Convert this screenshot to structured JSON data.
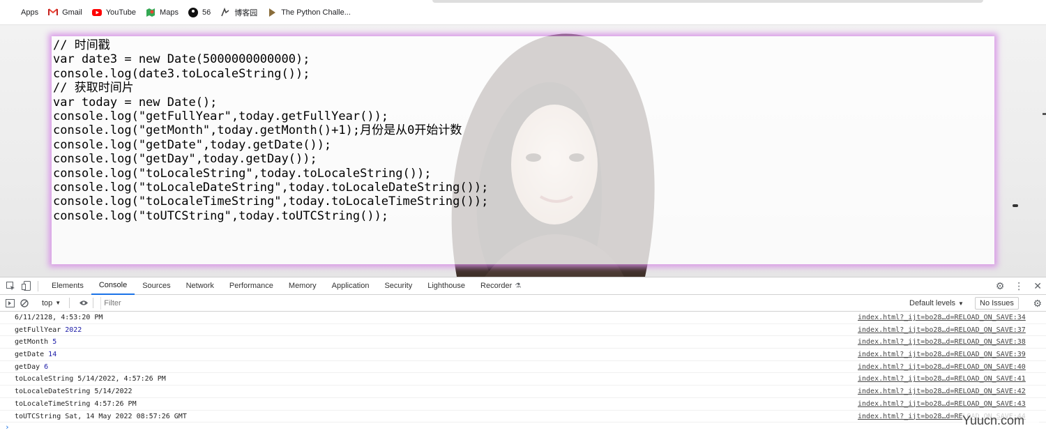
{
  "bookmarks": [
    {
      "label": "Apps",
      "icon": "apps-grid-icon"
    },
    {
      "label": "Gmail",
      "icon": "gmail-icon"
    },
    {
      "label": "YouTube",
      "icon": "youtube-icon"
    },
    {
      "label": "Maps",
      "icon": "maps-icon"
    },
    {
      "label": "56",
      "icon": "site-56-icon"
    },
    {
      "label": "博客园",
      "icon": "cnblogs-icon"
    },
    {
      "label": "The Python Challe...",
      "icon": "python-challenge-icon"
    }
  ],
  "code": {
    "lines": [
      "// 时间戳",
      "var date3 = new Date(5000000000000);",
      "console.log(date3.toLocaleString());",
      "// 获取时间片",
      "var today = new Date();",
      "console.log(\"getFullYear\",today.getFullYear());",
      "console.log(\"getMonth\",today.getMonth()+1);月份是从0开始计数",
      "console.log(\"getDate\",today.getDate());",
      "console.log(\"getDay\",today.getDay());",
      "console.log(\"toLocaleString\",today.toLocaleString());",
      "console.log(\"toLocaleDateString\",today.toLocaleDateString());",
      "console.log(\"toLocaleTimeString\",today.toLocaleTimeString());",
      "console.log(\"toUTCString\",today.toUTCString());"
    ]
  },
  "devtools": {
    "tabs": [
      "Elements",
      "Console",
      "Sources",
      "Network",
      "Performance",
      "Memory",
      "Application",
      "Security",
      "Lighthouse",
      "Recorder"
    ],
    "active_tab": "Console",
    "context": "top",
    "filter_placeholder": "Filter",
    "levels": "Default levels",
    "issues": "No Issues"
  },
  "console": {
    "rows": [
      {
        "text": "6/11/2128, 4:53:20 PM",
        "value": "",
        "source": "index.html?_ijt=bo28…d=RELOAD_ON_SAVE:34"
      },
      {
        "text": "getFullYear ",
        "value": "2022",
        "source": "index.html?_ijt=bo28…d=RELOAD_ON_SAVE:37"
      },
      {
        "text": "getMonth ",
        "value": "5",
        "source": "index.html?_ijt=bo28…d=RELOAD_ON_SAVE:38"
      },
      {
        "text": "getDate ",
        "value": "14",
        "source": "index.html?_ijt=bo28…d=RELOAD_ON_SAVE:39"
      },
      {
        "text": "getDay ",
        "value": "6",
        "source": "index.html?_ijt=bo28…d=RELOAD_ON_SAVE:40"
      },
      {
        "text": "toLocaleString 5/14/2022, 4:57:26 PM",
        "value": "",
        "source": "index.html?_ijt=bo28…d=RELOAD_ON_SAVE:41"
      },
      {
        "text": "toLocaleDateString 5/14/2022",
        "value": "",
        "source": "index.html?_ijt=bo28…d=RELOAD_ON_SAVE:42"
      },
      {
        "text": "toLocaleTimeString 4:57:26 PM",
        "value": "",
        "source": "index.html?_ijt=bo28…d=RELOAD_ON_SAVE:43"
      },
      {
        "text": "toUTCString Sat, 14 May 2022 08:57:26 GMT",
        "value": "",
        "source": "index.html?_ijt=bo28…d=RELOAD_ON_SAVE:44"
      }
    ],
    "prompt": "›"
  },
  "watermark": "Yuucn.com",
  "colors": {
    "box_glow": "#d68ce6",
    "active_tab": "#1a73e8",
    "number": "#1a1aa6"
  }
}
